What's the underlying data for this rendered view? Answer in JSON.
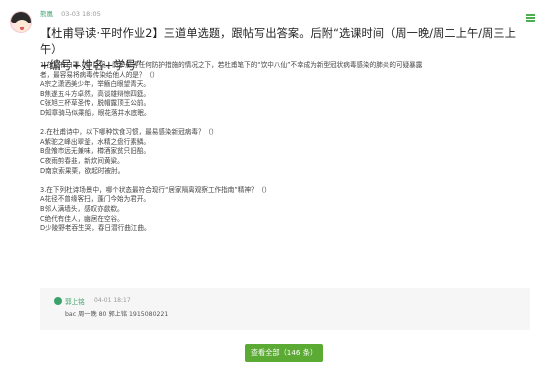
{
  "post": {
    "author": "熊凰",
    "time": "03-03 18:05",
    "title_line1": "【杜甫导读·平时作业2】三道单选题，跟帖写出答案。后附“选课时间（周一晚/周二上午/周三上午）",
    "title_line2": "+编号+姓名+学号”",
    "body": [
      "1.在没有口罩、护目镜、防护服等任何防护措施的情况之下，若杜甫笔下的“饮中八仙”不幸成为新型冠状病毒感染的肺炎的可疑暴露",
      "者，最容易将病毒传染给他人的是？（）",
      "A宗之潇洒美少年，举觞白眼望青天。",
      "B焦遂五斗方卓然，高谈雄辩惊四筵。",
      "C张旭三杯草圣传，脱帽露顶王公前。",
      "D知章骑马似乘船，眼花落井水底眠。",
      "",
      "2.在杜甫诗中，以下哪种饮食习惯，最易感染新冠病毒？（）",
      "A紫驼之峰出翠釜，水精之盘行素鳞。",
      "B盘飧市远无兼味，樽酒家贫只旧醅。",
      "C夜雨剪春韭，新炊间黄粱。",
      "D南京索果栗，欲起时被肘。",
      "",
      "3.在下列杜诗场景中，哪个状态最符合现行“居家隔离观察工作指南”精神？（）",
      "A花径不曾缘客扫，蓬门今始为君开。",
      "B邻人满墙头，感叹亦歔欷。",
      "C绝代有佳人，幽居在空谷。",
      "D少陵野老吞生哭，春日潜行曲江曲。"
    ]
  },
  "reply": {
    "author": "郭上铭",
    "time": "04-01 18:17",
    "text": "bac 周一晚 80 郭上铭 1915080221"
  },
  "show_all_label": "查看全部（146 条）",
  "colors": {
    "accent": "#3aa26a",
    "button": "#5aaa33"
  }
}
